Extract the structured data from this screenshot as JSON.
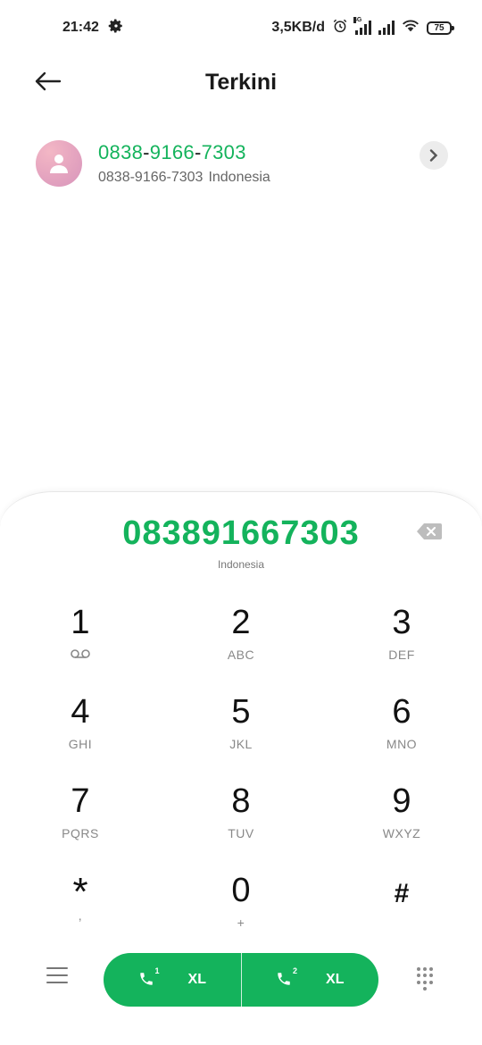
{
  "status_bar": {
    "time": "21:42",
    "network_speed": "3,5KB/d",
    "network_type": "4G",
    "battery": "75",
    "icons": [
      "gear-icon",
      "alarm-icon",
      "signal-icon",
      "signal-icon",
      "wifi-icon",
      "battery-icon"
    ]
  },
  "header": {
    "title": "Terkini",
    "back_icon": "arrow-left-icon"
  },
  "result": {
    "number_parts": [
      "0838",
      "-",
      "9166",
      "-",
      "7303"
    ],
    "subtitle_number": "0838-9166-7303",
    "subtitle_location": "Indonesia",
    "avatar_icon": "person-icon",
    "chevron_icon": "chevron-right-icon"
  },
  "dialer": {
    "dialed_number": "083891667303",
    "country": "Indonesia",
    "backspace_icon": "backspace-icon",
    "keys": [
      {
        "digit": "1",
        "letters": ""
      },
      {
        "digit": "2",
        "letters": "ABC"
      },
      {
        "digit": "3",
        "letters": "DEF"
      },
      {
        "digit": "4",
        "letters": "GHI"
      },
      {
        "digit": "5",
        "letters": "JKL"
      },
      {
        "digit": "6",
        "letters": "MNO"
      },
      {
        "digit": "7",
        "letters": "PQRS"
      },
      {
        "digit": "8",
        "letters": "TUV"
      },
      {
        "digit": "9",
        "letters": "WXYZ"
      },
      {
        "digit": "*",
        "letters": ","
      },
      {
        "digit": "0",
        "letters": "+"
      },
      {
        "digit": "#",
        "letters": ""
      }
    ]
  },
  "actions": {
    "menu_icon": "menu-icon",
    "sim1_label": "XL",
    "sim1_slot": "1",
    "sim2_label": "XL",
    "sim2_slot": "2",
    "keypad_toggle_icon": "dialpad-icon",
    "accent_color": "#14b35c"
  }
}
